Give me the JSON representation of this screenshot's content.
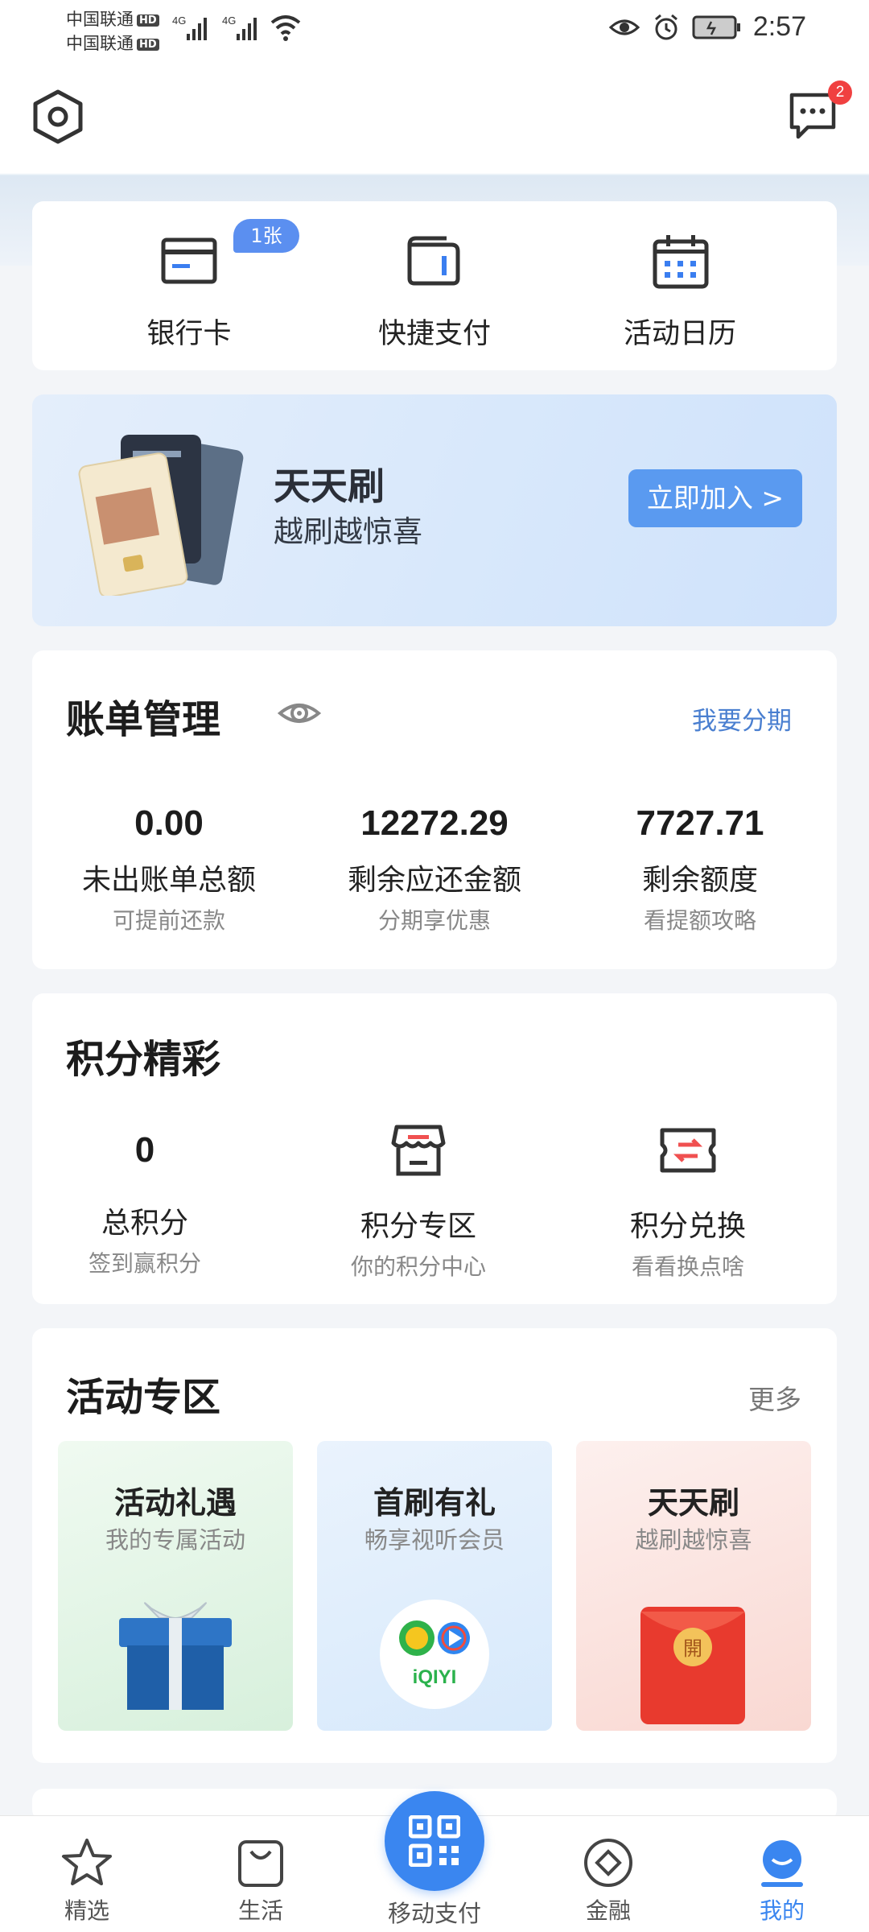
{
  "status_bar": {
    "carrier1": "中国联通",
    "carrier2": "中国联通",
    "hd": "HD",
    "network": "4G",
    "time": "2:57"
  },
  "header": {
    "message_badge": "2"
  },
  "quick_actions": [
    {
      "label": "银行卡",
      "badge": "1张",
      "icon": "bank-card-icon"
    },
    {
      "label": "快捷支付",
      "icon": "wallet-icon"
    },
    {
      "label": "活动日历",
      "icon": "calendar-icon"
    }
  ],
  "banner": {
    "title": "天天刷",
    "subtitle": "越刷越惊喜",
    "button": "立即加入 >"
  },
  "bill": {
    "title": "账单管理",
    "link": "我要分期",
    "items": [
      {
        "value": "0.00",
        "label": "未出账单总额",
        "sub": "可提前还款"
      },
      {
        "value": "12272.29",
        "label": "剩余应还金额",
        "sub": "分期享优惠"
      },
      {
        "value": "7727.71",
        "label": "剩余额度",
        "sub": "看提额攻略"
      }
    ]
  },
  "points": {
    "title": "积分精彩",
    "items": [
      {
        "value": "0",
        "label": "总积分",
        "sub": "签到赢积分"
      },
      {
        "label": "积分专区",
        "sub": "你的积分中心",
        "icon": "store-icon"
      },
      {
        "label": "积分兑换",
        "sub": "看看换点啥",
        "icon": "ticket-icon"
      }
    ]
  },
  "activities": {
    "title": "活动专区",
    "more": "更多",
    "cards": [
      {
        "title": "活动礼遇",
        "sub": "我的专属活动",
        "bg": "#e3f5e6"
      },
      {
        "title": "首刷有礼",
        "sub": "畅享视听会员",
        "bg": "#e2effc"
      },
      {
        "title": "天天刷",
        "sub": "越刷越惊喜",
        "bg": "#fbe7e3"
      }
    ],
    "red_envelope_char": "開",
    "iqiyi_text": "iQIYI"
  },
  "bottom_nav": {
    "items": [
      "精选",
      "生活",
      "移动支付",
      "金融",
      "我的"
    ],
    "active_color": "#3a86f0"
  }
}
